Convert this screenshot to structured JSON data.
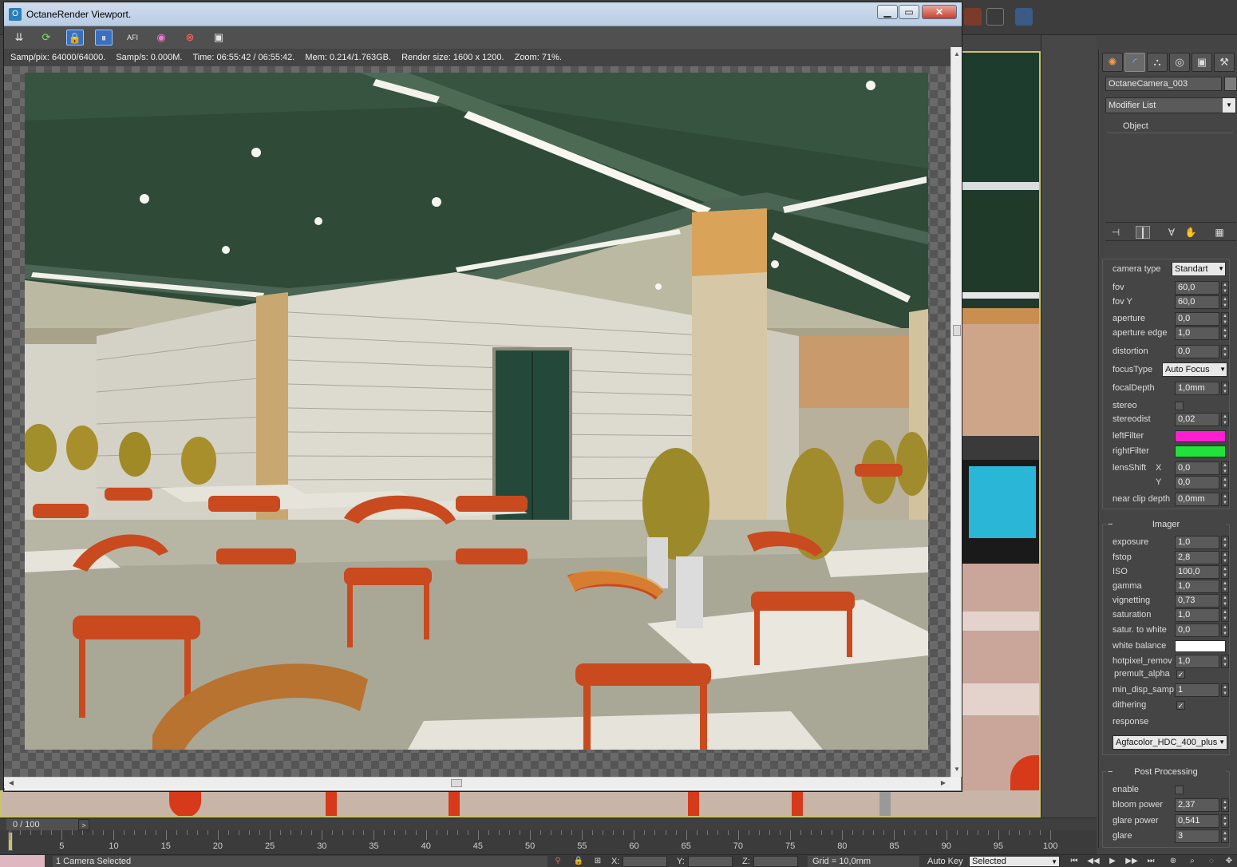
{
  "window": {
    "title": "OctaneRender Viewport.",
    "minimize": "▁",
    "maximize": "▭",
    "close": "✕"
  },
  "toolbar_icons": [
    "send-icon",
    "refresh-icon",
    "lock-icon",
    "pause-icon",
    "afi-icon",
    "color-picker-icon",
    "focus-icon",
    "display-icon"
  ],
  "toolbar_glyphs": [
    "⇊",
    "⟳",
    "🔒",
    "⏸",
    "AFI",
    "◉",
    "⊗",
    "▣"
  ],
  "stats": {
    "samp_pix": "Samp/pix: 64000/64000.",
    "samp_s": "Samp/s: 0.000M.",
    "time": "Time: 06:55:42 / 06:55:42.",
    "mem": "Mem: 0.214/1.763GB.",
    "render_size": "Render size: 1600 x 1200.",
    "zoom": "Zoom: 71%."
  },
  "command_panel": {
    "tabs": [
      "✺",
      "◜",
      "⛬",
      "◎",
      "▣",
      "⚒"
    ],
    "object_name": "OctaneCamera_003",
    "modifier_list": "Modifier List",
    "stack_item": "Object",
    "stack_tools": [
      "⊣",
      "┃",
      "∀",
      "✋",
      "▦"
    ],
    "camera": {
      "camera_type_label": "camera type",
      "camera_type_value": "Standart",
      "fov_label": "fov",
      "fov_value": "60,0",
      "fovy_label": "fov Y",
      "fovy_value": "60,0",
      "aperture_label": "aperture",
      "aperture_value": "0,0",
      "aperture_edge_label": "aperture edge",
      "aperture_edge_value": "1,0",
      "distortion_label": "distortion",
      "distortion_value": "0,0",
      "focus_type_label": "focusType",
      "focus_type_value": "Auto Focus",
      "focal_depth_label": "focalDepth",
      "focal_depth_value": "1,0mm",
      "stereo_label": "stereo",
      "stereodist_label": "stereodist",
      "stereodist_value": "0,02",
      "left_filter_label": "leftFilter",
      "right_filter_label": "rightFilter",
      "lens_shift_label": "lensShift",
      "lens_x_label": "X",
      "lens_x_value": "0,0",
      "lens_y_label": "Y",
      "lens_y_value": "0,0",
      "near_clip_label": "near clip depth",
      "near_clip_value": "0,0mm"
    },
    "imager": {
      "header": "Imager",
      "exposure_label": "exposure",
      "exposure_value": "1,0",
      "fstop_label": "fstop",
      "fstop_value": "2,8",
      "iso_label": "ISO",
      "iso_value": "100,0",
      "gamma_label": "gamma",
      "gamma_value": "1,0",
      "vignetting_label": "vignetting",
      "vignetting_value": "0,73",
      "saturation_label": "saturation",
      "saturation_value": "1,0",
      "satur_white_label": "satur. to white",
      "satur_white_value": "0,0",
      "white_balance_label": "white balance",
      "hotpixel_label": "hotpixel_remov",
      "hotpixel_value": "1,0",
      "premult_label": "premult_alpha",
      "min_disp_label": "min_disp_samp.",
      "min_disp_value": "1",
      "dithering_label": "dithering",
      "response_label": "response",
      "response_value": "Agfacolor_HDC_400_plus"
    },
    "post": {
      "header": "Post Processing",
      "enable_label": "enable",
      "bloom_label": "bloom power",
      "bloom_value": "2,37",
      "glare_power_label": "glare power",
      "glare_power_value": "0,541",
      "glare_label": "glare",
      "glare_value": "3"
    }
  },
  "colors": {
    "left_filter": "#ff1fd0",
    "right_filter": "#1fe33a",
    "white_balance": "#ffffff",
    "accent": "#3a6fbe"
  },
  "timeline": {
    "frame_counter": "0 / 100",
    "ticks": [
      "5",
      "10",
      "15",
      "20",
      "25",
      "30",
      "35",
      "40",
      "45",
      "50",
      "55",
      "60",
      "65",
      "70",
      "75",
      "80",
      "85",
      "90",
      "95",
      "100"
    ]
  },
  "status": {
    "selection": "1 Camera Selected",
    "x_label": "X:",
    "y_label": "Y:",
    "z_label": "Z:",
    "grid": "Grid = 10,0mm",
    "auto_key": "Auto Key",
    "selected_dd": "Selected"
  }
}
